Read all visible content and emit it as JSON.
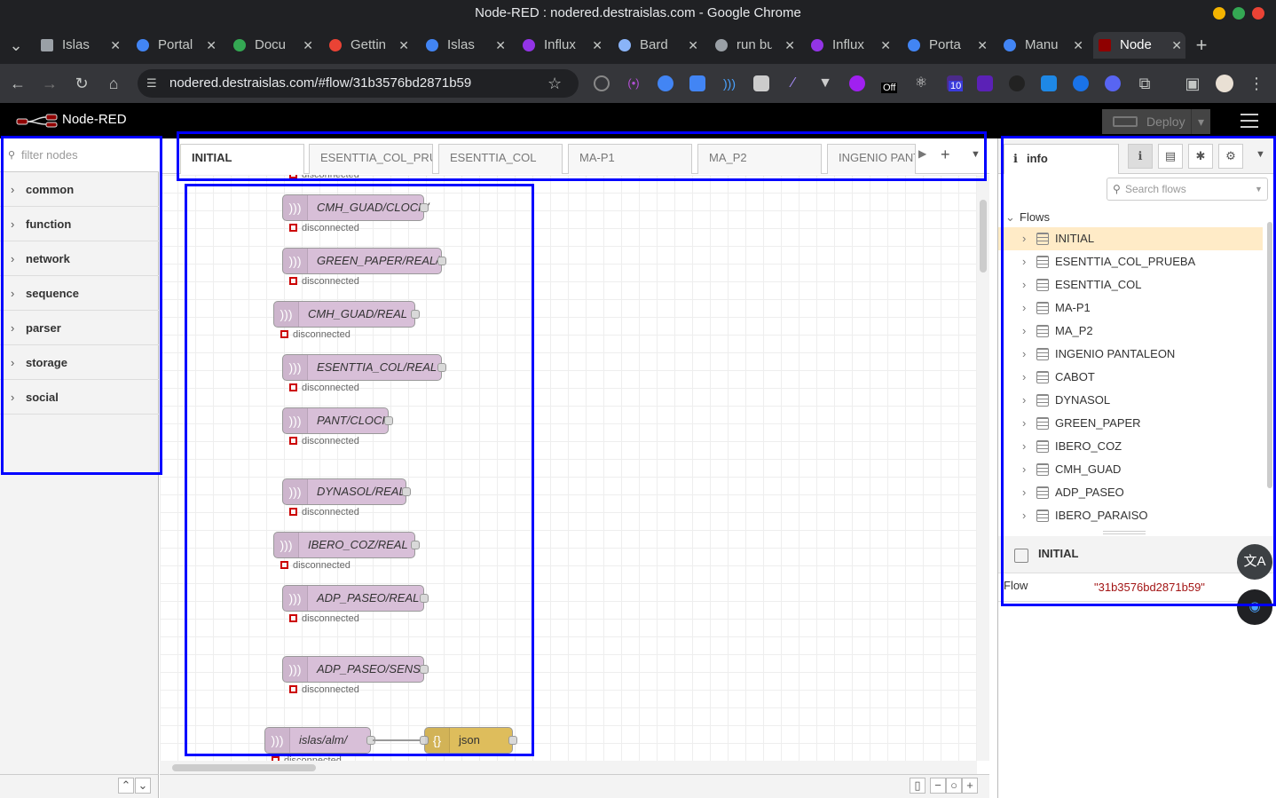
{
  "browser": {
    "window_title": "Node-RED : nodered.destraislas.com - Google Chrome",
    "tabs": [
      {
        "label": "Islas",
        "color": "#9aa0a6"
      },
      {
        "label": "Portal",
        "color": "#4285f4"
      },
      {
        "label": "Docu",
        "color": "#34a853"
      },
      {
        "label": "Gettin",
        "color": "#ea4335"
      },
      {
        "label": "Islas",
        "color": "#4285f4"
      },
      {
        "label": "Influx",
        "color": "#9334e6"
      },
      {
        "label": "Bard",
        "color": "#8ab4f8"
      },
      {
        "label": "run bu",
        "color": "#9aa0a6"
      },
      {
        "label": "Influx",
        "color": "#9334e6"
      },
      {
        "label": "Porta",
        "color": "#4285f4"
      },
      {
        "label": "Manu",
        "color": "#4285f4"
      },
      {
        "label": "Node",
        "color": "#8f0000"
      }
    ],
    "new_tab": "+",
    "url": "nodered.destraislas.com/#flow/31b3576bd2871b59",
    "ext_badge_off": "Off",
    "ext_badge_count": "10"
  },
  "nodered": {
    "app_title": "Node-RED",
    "deploy_label": "Deploy",
    "palette": {
      "filter_placeholder": "filter nodes",
      "categories": [
        "common",
        "function",
        "network",
        "sequence",
        "parser",
        "storage",
        "social"
      ]
    },
    "workspace": {
      "tabs": [
        "INITIAL",
        "ESENTTIA_COL_PRUEBA",
        "ESENTTIA_COL",
        "MA-P1",
        "MA_P2",
        "INGENIO PANTALEON"
      ],
      "add_tab": "+",
      "top_status": "disconnected",
      "nodes": [
        {
          "label": "CMH_GUAD/CLOCK/",
          "status": "disconnected"
        },
        {
          "label": "GREEN_PAPER/REAL/",
          "status": "disconnected"
        },
        {
          "label": "CMH_GUAD/REAL",
          "status": "disconnected"
        },
        {
          "label": "ESENTTIA_COL/REAL",
          "status": "disconnected"
        },
        {
          "label": "PANT/CLOCK",
          "status": "disconnected"
        },
        {
          "label": "DYNASOL/REAL",
          "status": "disconnected"
        },
        {
          "label": "IBERO_COZ/REAL",
          "status": "disconnected"
        },
        {
          "label": "ADP_PASEO/REAL",
          "status": "disconnected"
        },
        {
          "label": "ADP_PASEO/SENS",
          "status": "disconnected"
        },
        {
          "label": "islas/alm/",
          "status": "disconnected"
        }
      ],
      "json_node": "json"
    },
    "sidebar": {
      "info_tab": "info",
      "search_placeholder": "Search flows",
      "flows_header": "Flows",
      "flows": [
        "INITIAL",
        "ESENTTIA_COL_PRUEBA",
        "ESENTTIA_COL",
        "MA-P1",
        "MA_P2",
        "INGENIO PANTALEON",
        "CABOT",
        "DYNASOL",
        "GREEN_PAPER",
        "IBERO_COZ",
        "CMH_GUAD",
        "ADP_PASEO",
        "IBERO_PARAISO"
      ],
      "selected_flow": "INITIAL",
      "detail_title": "INITIAL",
      "detail_key": "Flow",
      "detail_value": "\"31b3576bd2871b59\""
    }
  },
  "colors": {
    "highlight": "#0000ff",
    "selected_row": "#ffebc7",
    "mqtt_node": "#d8bfd8",
    "json_node": "#debd5c",
    "status_error": "#cc0000"
  }
}
